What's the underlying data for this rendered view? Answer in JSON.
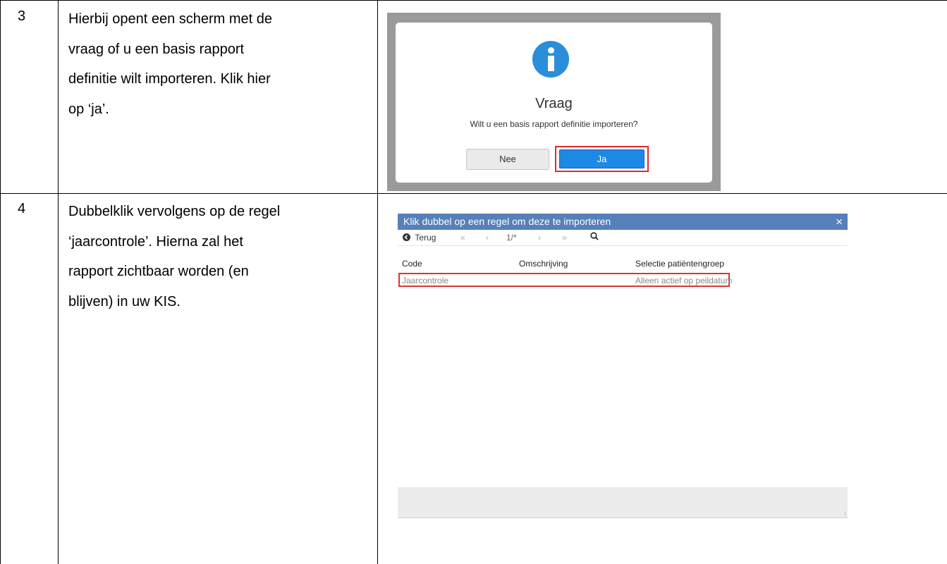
{
  "rows": [
    {
      "number": "3",
      "text_lines": [
        "Hierbij opent een scherm met de",
        "vraag of u een basis rapport",
        "definitie wilt importeren. Klik hier",
        "op ‘ja’."
      ],
      "dialog": {
        "icon": "info-icon",
        "title": "Vraag",
        "question": "Wilt u een basis rapport definitie importeren?",
        "no_label": "Nee",
        "yes_label": "Ja",
        "accent": "#1e88e5",
        "highlight_color": "#e22828"
      }
    },
    {
      "number": "4",
      "text_lines": [
        "Dubbelklik vervolgens op de regel",
        "‘jaarcontrole’. Hierna zal het",
        "rapport zichtbaar worden (en",
        "blijven) in uw KIS."
      ],
      "import_window": {
        "title": "Klik dubbel op een regel om deze te importeren",
        "close_icon": "×",
        "toolbar": {
          "back_label": "Terug",
          "first": "«",
          "prev": "‹",
          "page": "1/*",
          "next": "›",
          "last": "»",
          "search_icon": "search-icon"
        },
        "columns": [
          "Code",
          "Omschrijving",
          "Selectie patiëntengroep"
        ],
        "table_rows": [
          {
            "code": "Jaarcontrole",
            "omschrijving": "",
            "selectie": "Alleen actief op peildatum"
          }
        ],
        "header_color": "#5680b8",
        "highlight_color": "#d93636"
      }
    }
  ]
}
